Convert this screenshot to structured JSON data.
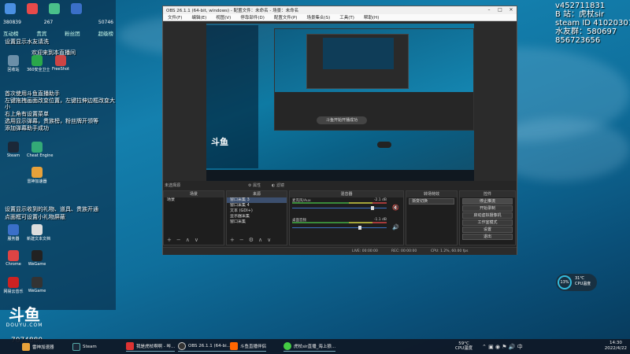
{
  "left_panel": {
    "top_labels": [
      "",
      "",
      "",
      ""
    ],
    "stats": [
      "380839",
      "267",
      "",
      "50746"
    ],
    "tabs": [
      "互动榜",
      "贵宾",
      "粉丝团",
      "超级榜"
    ],
    "lines": [
      "设置显示水友请洗",
      "欢迎来到本直播间",
      "首次使用斗鱼直播助手",
      "左键拖拽画面改变位置，左键拉伸边框改变大小",
      "右上角有设置菜单",
      "选用显示弹幕，贵族榜，粉丝牌开领等",
      "添加弹幕助手成功",
      "设置显示收到的礼物、道具、贵族开通",
      "点面框可设置小礼物屏蔽"
    ],
    "desktop_icons": [
      "回收站",
      "360安全卫士",
      "FreeShot",
      "Steam",
      "Cheat Engine",
      "雷神加速器",
      "服务器",
      "新建文本文档",
      "Chrome",
      "WeGame",
      "网易云音乐",
      "WeGame"
    ]
  },
  "douyu": {
    "logo": "斗鱼",
    "sub": "DOUYU.COM",
    "room_number": "7074880"
  },
  "right_info": [
    "v452711831",
    "B 站：虎杖sir",
    "steam ID 410203017",
    "水友群：580697",
    "856723656"
  ],
  "obs": {
    "title": "OBS 26.1.1 (64-bit, windows) - 配置文件：未命名 - 场景：未命名",
    "menu": [
      "文件(F)",
      "编辑(E)",
      "视图(V)",
      "停靠部件(D)",
      "配置文件(P)",
      "场景集合(S)",
      "工具(T)",
      "帮助(H)"
    ],
    "preview_toast": "斗鱼开始开播成功",
    "no_source_label": "未选择源",
    "props_button": "属性",
    "filters_button": "滤镜",
    "docks": {
      "scenes_title": "场景",
      "scenes": [
        "场景"
      ],
      "sources_title": "来源",
      "sources": [
        "窗口采集 3",
        "窗口采集 4",
        "文本 (GDI+)",
        "显示器采集",
        "窗口采集"
      ],
      "mixer_title": "混音器",
      "mixer": [
        {
          "name": "麦克风/Aux",
          "value": "-2.1 dB"
        },
        {
          "name": "桌面音频",
          "value": "-1.1 dB"
        }
      ],
      "transitions_title": "转场特效",
      "transition": "渐变切换",
      "controls_title": "控件",
      "controls": [
        "停止推流",
        "开始录制",
        "启动虚拟摄像机",
        "工作室模式",
        "设置",
        "退出"
      ]
    },
    "status": {
      "live": "LIVE: 00:00:00",
      "rec": "REC: 00:00:00",
      "cpu": "CPU: 1.2%, 60.00 fps"
    }
  },
  "cpu_widget": {
    "percent": "13%",
    "temp": "31℃",
    "label": "CPU温度"
  },
  "taskbar": {
    "items": [
      "雷神加速器",
      "Steam",
      "我是虎杖啊啊 - 哔...",
      "OBS 26.1.1 (64-bi...",
      "斗鱼直播伴侣",
      "虎杖sir直播_海上狼..."
    ],
    "cpu_temp": "59°C",
    "cpu_label": "CPU温度",
    "time": "14:30",
    "date": "2022/4/22"
  },
  "colors": {
    "accent": "#3bbbdd",
    "obs_bg": "#2b2b2b",
    "taskbar": "#0f1928"
  }
}
